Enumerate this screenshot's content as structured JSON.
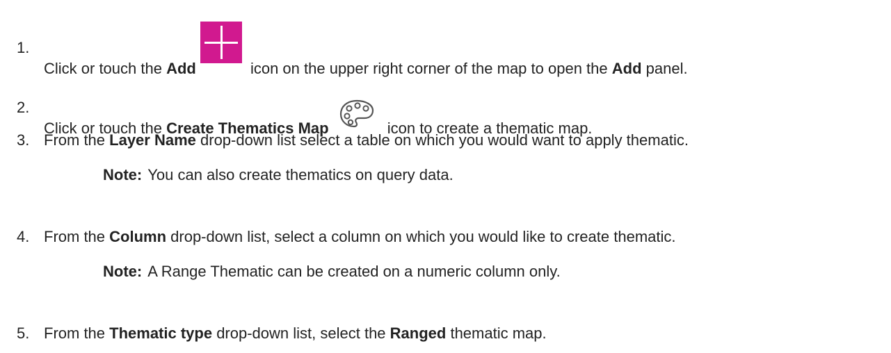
{
  "steps": [
    {
      "number": "1.",
      "parts": [
        "Click or touch the ",
        "Add",
        " icon on the upper right corner of the map to open the ",
        "Add",
        " panel."
      ],
      "icon": "add-plus-icon",
      "icon_color": "#d1198f"
    },
    {
      "number": "2.",
      "parts": [
        "Click or touch the ",
        "Create Thematics Map",
        " icon to create a thematic map."
      ],
      "icon": "palette-icon"
    },
    {
      "number": "3.",
      "parts": [
        "From the ",
        "Layer Name",
        " drop-down list select a table on which you would want to apply thematic."
      ],
      "note": {
        "label": "Note:",
        "text": "You can also create thematics on query data."
      }
    },
    {
      "number": "4.",
      "parts": [
        "From the ",
        "Column",
        " drop-down list, select a column on which you would like to create thematic."
      ],
      "note": {
        "label": "Note:",
        "text": "A Range Thematic can be created on a numeric column only."
      }
    },
    {
      "number": "5.",
      "parts": [
        "From the ",
        "Thematic type",
        " drop-down list, select the ",
        "Ranged",
        " thematic map."
      ]
    }
  ]
}
